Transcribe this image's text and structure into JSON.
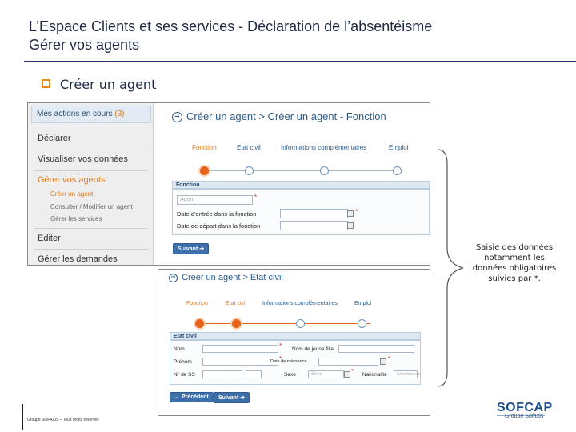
{
  "slide": {
    "title_line1": "L’Espace Clients et ses services - Déclaration de l’absentéisme",
    "title_line2": "Gérer vos agents",
    "bullet": "Créer un agent",
    "note": "Saisie des données notamment les données obligatoires suivies par *.",
    "footer": "Groupe SOFAXIS – Tous droits réservés",
    "logo_name": "SOFCAP",
    "logo_sub": "Groupe Sofaxis"
  },
  "shot1": {
    "sidebar": {
      "actions_label": "Mes actions en cours",
      "actions_count": "(3)",
      "items": {
        "declarer": "Déclarer",
        "visualiser": "Visualiser vos données",
        "gerer_agents": "Gérer vos agents",
        "creer": "Créer un agent",
        "consulter": "Consulter / Modifier un agent",
        "gerer_services": "Gérer les services",
        "editer": "Editer",
        "gerer_demandes": "Gérer les demandes"
      }
    },
    "heading": "Créer un agent > Créer un agent - Fonction",
    "steps": [
      "Fonction",
      "Etat civil",
      "Informations complémentaires",
      "Emploi"
    ],
    "fieldset_title": "Fonction",
    "select_placeholder": "Agent",
    "field_entree": "Date d'entrée dans la fonction",
    "field_depart": "Date de départ dans la fonction",
    "button_next": "Suivant"
  },
  "shot2": {
    "heading": "Créer un agent > Etat civil",
    "steps": [
      "Fonction",
      "Etat civil",
      "Informations complémentaires",
      "Emploi"
    ],
    "fieldset_title": "Etat civil",
    "labels": {
      "nom": "Nom",
      "nom_jeune_fille": "Nom de jeune fille",
      "prenom": "Prénom",
      "date_naissance": "Date de naissance",
      "num_ss": "N° de SS",
      "sexe": "Sexe",
      "nationalite": "Nationalité"
    },
    "sexe_value": "Sexe",
    "nationalite_value": "Sélectionnez",
    "button_prev": "Précédent",
    "button_next": "Suivant"
  }
}
